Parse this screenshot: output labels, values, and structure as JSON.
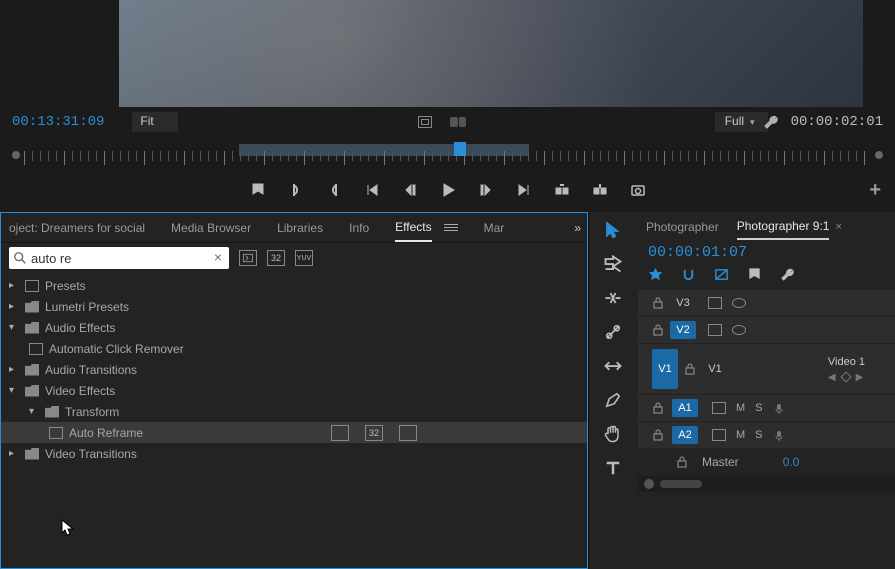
{
  "monitor": {
    "tc_left": "00:13:31:09",
    "zoom": "Fit",
    "quality": "Full",
    "tc_right": "00:00:02:01"
  },
  "effects_panel": {
    "tabs": [
      "oject: Dreamers for social",
      "Media Browser",
      "Libraries",
      "Info",
      "Effects",
      "Mar"
    ],
    "active_tab": "Effects",
    "search_value": "auto re",
    "tree": {
      "presets": "Presets",
      "lumetri": "Lumetri Presets",
      "audio_fx": "Audio Effects",
      "auto_click": "Automatic Click Remover",
      "audio_trans": "Audio Transitions",
      "video_fx": "Video Effects",
      "transform": "Transform",
      "auto_reframe": "Auto Reframe",
      "video_trans": "Video Transitions"
    }
  },
  "timeline": {
    "tabs": [
      "Photographer",
      "Photographer 9:1"
    ],
    "active_tab": "Photographer 9:1",
    "tc": "00:00:01:07",
    "tracks": {
      "v3": "V3",
      "v2": "V2",
      "v1_left": "V1",
      "v1_right": "V1",
      "clip_v1": "Video 1",
      "a1": "A1",
      "a2": "A2",
      "m": "M",
      "s": "S",
      "master": "Master",
      "master_val": "0.0"
    }
  }
}
